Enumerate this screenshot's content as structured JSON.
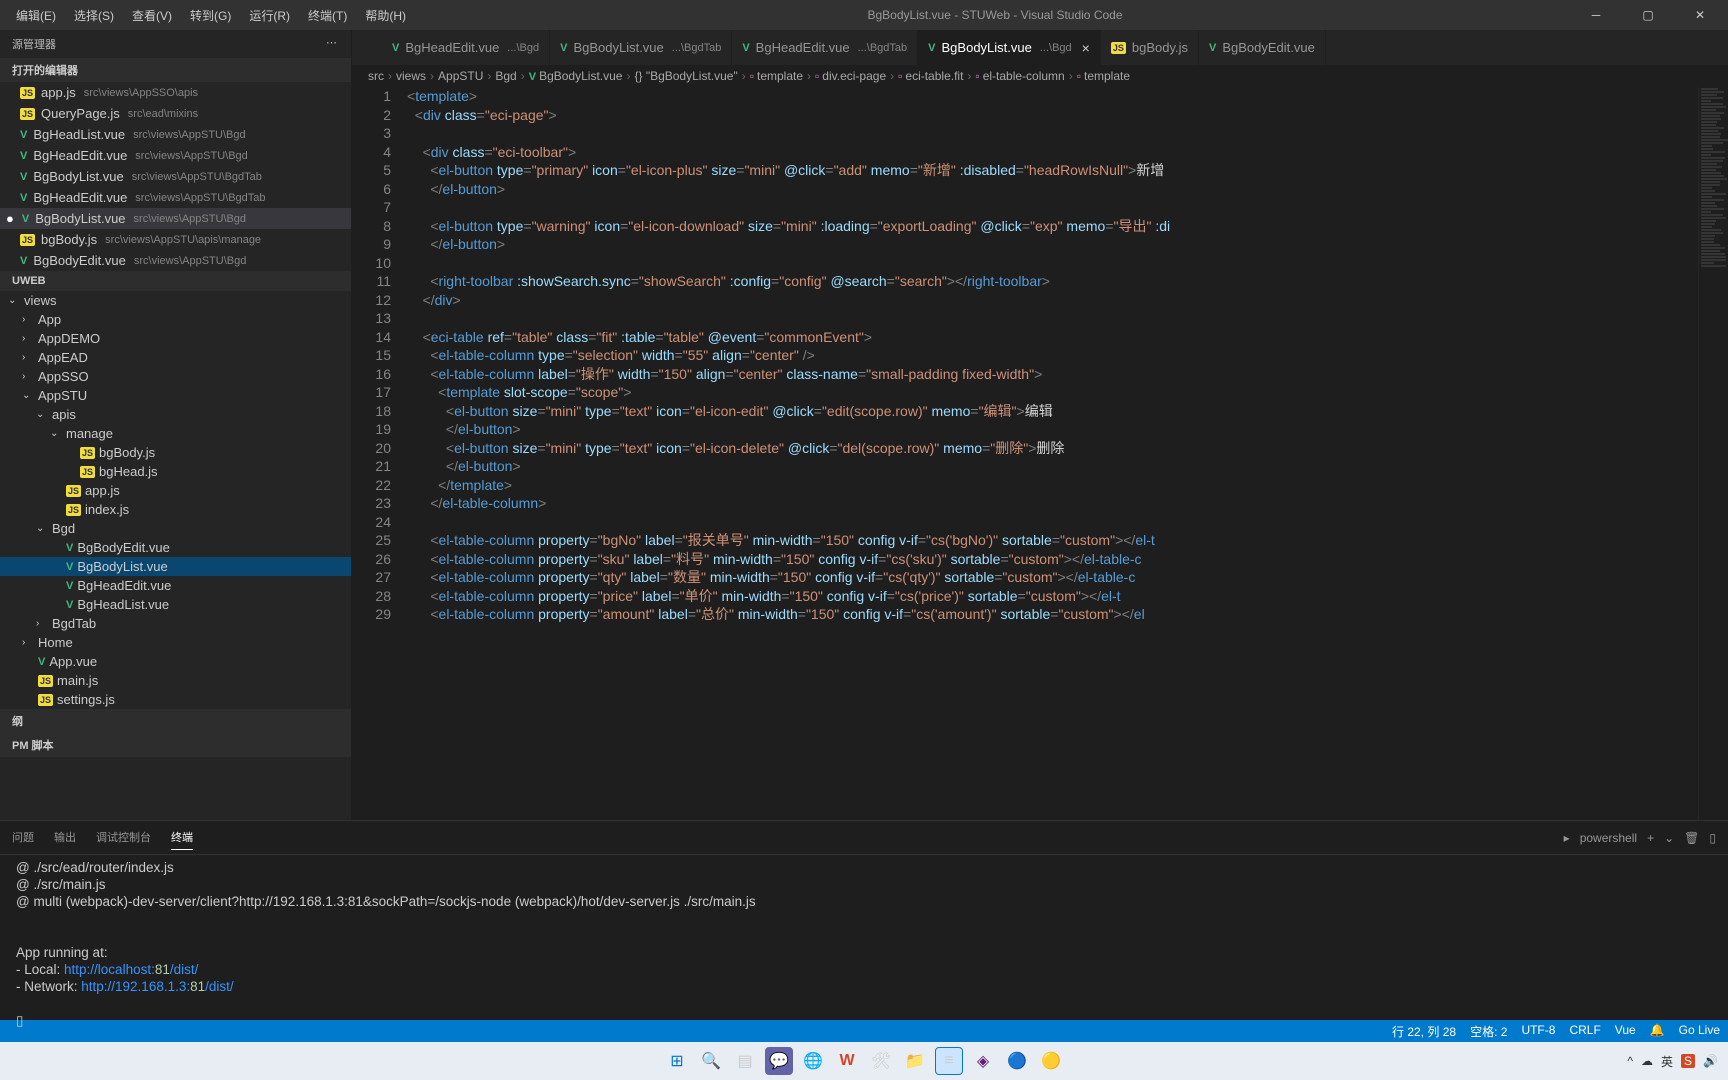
{
  "titlebar": {
    "menus": [
      "编辑(E)",
      "选择(S)",
      "查看(V)",
      "转到(G)",
      "运行(R)",
      "终端(T)",
      "帮助(H)"
    ],
    "title": "BgBodyList.vue - STUWeb - Visual Studio Code"
  },
  "sidebar": {
    "title": "源管理器",
    "section_open": "打开的编辑器",
    "open_editors": [
      {
        "icon": "js",
        "name": "app.js",
        "path": "src\\views\\AppSSO\\apis"
      },
      {
        "icon": "js",
        "name": "QueryPage.js",
        "path": "src\\ead\\mixins"
      },
      {
        "icon": "v",
        "name": "BgHeadList.vue",
        "path": "src\\views\\AppSTU\\Bgd"
      },
      {
        "icon": "v",
        "name": "BgHeadEdit.vue",
        "path": "src\\views\\AppSTU\\Bgd"
      },
      {
        "icon": "v",
        "name": "BgBodyList.vue",
        "path": "src\\views\\AppSTU\\BgdTab"
      },
      {
        "icon": "v",
        "name": "BgHeadEdit.vue",
        "path": "src\\views\\AppSTU\\BgdTab"
      },
      {
        "icon": "v",
        "name": "BgBodyList.vue",
        "path": "src\\views\\AppSTU\\Bgd",
        "active": true
      },
      {
        "icon": "js",
        "name": "bgBody.js",
        "path": "src\\views\\AppSTU\\apis\\manage"
      },
      {
        "icon": "v",
        "name": "BgBodyEdit.vue",
        "path": "src\\views\\AppSTU\\Bgd"
      }
    ],
    "project": "UWEB",
    "tree": [
      {
        "indent": 0,
        "chev": "⌄",
        "name": "views"
      },
      {
        "indent": 1,
        "chev": "›",
        "name": "App"
      },
      {
        "indent": 1,
        "chev": "›",
        "name": "AppDEMO"
      },
      {
        "indent": 1,
        "chev": "›",
        "name": "AppEAD"
      },
      {
        "indent": 1,
        "chev": "›",
        "name": "AppSSO"
      },
      {
        "indent": 1,
        "chev": "⌄",
        "name": "AppSTU"
      },
      {
        "indent": 2,
        "chev": "⌄",
        "name": "apis"
      },
      {
        "indent": 3,
        "chev": "⌄",
        "name": "manage"
      },
      {
        "indent": 4,
        "icon": "js",
        "name": "bgBody.js"
      },
      {
        "indent": 4,
        "icon": "js",
        "name": "bgHead.js"
      },
      {
        "indent": 3,
        "icon": "js",
        "name": "app.js"
      },
      {
        "indent": 3,
        "icon": "js",
        "name": "index.js"
      },
      {
        "indent": 2,
        "chev": "⌄",
        "name": "Bgd"
      },
      {
        "indent": 3,
        "icon": "v",
        "name": "BgBodyEdit.vue"
      },
      {
        "indent": 3,
        "icon": "v",
        "name": "BgBodyList.vue",
        "selected": true
      },
      {
        "indent": 3,
        "icon": "v",
        "name": "BgHeadEdit.vue"
      },
      {
        "indent": 3,
        "icon": "v",
        "name": "BgHeadList.vue"
      },
      {
        "indent": 2,
        "chev": "›",
        "name": "BgdTab"
      },
      {
        "indent": 1,
        "chev": "›",
        "name": "Home"
      },
      {
        "indent": 1,
        "icon": "v",
        "name": "App.vue"
      },
      {
        "indent": 1,
        "icon": "js",
        "name": "main.js"
      },
      {
        "indent": 1,
        "icon": "js",
        "name": "settings.js"
      }
    ],
    "outline": "纲",
    "npm": "PM 脚本"
  },
  "tabs": [
    {
      "icon": "v",
      "name": "BgHeadEdit.vue",
      "path": "...\\Bgd"
    },
    {
      "icon": "v",
      "name": "BgBodyList.vue",
      "path": "...\\BgdTab"
    },
    {
      "icon": "v",
      "name": "BgHeadEdit.vue",
      "path": "...\\BgdTab"
    },
    {
      "icon": "v",
      "name": "BgBodyList.vue",
      "path": "...\\Bgd",
      "active": true,
      "close": true
    },
    {
      "icon": "js",
      "name": "bgBody.js"
    },
    {
      "icon": "v",
      "name": "BgBodyEdit.vue"
    }
  ],
  "breadcrumb": [
    "src",
    "views",
    "AppSTU",
    "Bgd",
    "BgBodyList.vue",
    "{} \"BgBodyList.vue\"",
    "template",
    "div.eci-page",
    "eci-table.fit",
    "el-table-column",
    "template"
  ],
  "code": {
    "lines": [
      {
        "n": 1,
        "html": "<span class='punct'>&lt;</span><span class='tag'>template</span><span class='punct'>&gt;</span>"
      },
      {
        "n": 2,
        "html": "  <span class='punct'>&lt;</span><span class='tag'>div</span> <span class='attr'>class</span><span class='punct'>=</span><span class='str'>\"eci-page\"</span><span class='punct'>&gt;</span>"
      },
      {
        "n": 3,
        "html": ""
      },
      {
        "n": 4,
        "html": "    <span class='punct'>&lt;</span><span class='tag'>div</span> <span class='attr'>class</span><span class='punct'>=</span><span class='str'>\"eci-toolbar\"</span><span class='punct'>&gt;</span>"
      },
      {
        "n": 5,
        "html": "      <span class='punct'>&lt;</span><span class='tag'>el-button</span> <span class='attr'>type</span><span class='punct'>=</span><span class='str'>\"primary\"</span> <span class='attr'>icon</span><span class='punct'>=</span><span class='str'>\"el-icon-plus\"</span> <span class='attr'>size</span><span class='punct'>=</span><span class='str'>\"mini\"</span> <span class='attr'>@click</span><span class='punct'>=</span><span class='str'>\"add\"</span> <span class='attr'>memo</span><span class='punct'>=</span><span class='str'>\"新增\"</span> <span class='attr'>:disabled</span><span class='punct'>=</span><span class='str'>\"headRowIsNull\"</span><span class='punct'>&gt;</span><span class='text'>新增</span>"
      },
      {
        "n": 6,
        "html": "      <span class='punct'>&lt;/</span><span class='tag'>el-button</span><span class='punct'>&gt;</span>"
      },
      {
        "n": 7,
        "html": ""
      },
      {
        "n": 8,
        "html": "      <span class='punct'>&lt;</span><span class='tag'>el-button</span> <span class='attr'>type</span><span class='punct'>=</span><span class='str'>\"warning\"</span> <span class='attr'>icon</span><span class='punct'>=</span><span class='str'>\"el-icon-download\"</span> <span class='attr'>size</span><span class='punct'>=</span><span class='str'>\"mini\"</span> <span class='attr'>:loading</span><span class='punct'>=</span><span class='str'>\"exportLoading\"</span> <span class='attr'>@click</span><span class='punct'>=</span><span class='str'>\"exp\"</span> <span class='attr'>memo</span><span class='punct'>=</span><span class='str'>\"导出\"</span> <span class='attr'>:di</span>"
      },
      {
        "n": 9,
        "html": "      <span class='punct'>&lt;/</span><span class='tag'>el-button</span><span class='punct'>&gt;</span>"
      },
      {
        "n": 10,
        "html": ""
      },
      {
        "n": 11,
        "html": "      <span class='punct'>&lt;</span><span class='tag'>right-toolbar</span> <span class='attr'>:showSearch.sync</span><span class='punct'>=</span><span class='str'>\"showSearch\"</span> <span class='attr'>:config</span><span class='punct'>=</span><span class='str'>\"config\"</span> <span class='attr'>@search</span><span class='punct'>=</span><span class='str'>\"search\"</span><span class='punct'>&gt;&lt;/</span><span class='tag'>right-toolbar</span><span class='punct'>&gt;</span>"
      },
      {
        "n": 12,
        "html": "    <span class='punct'>&lt;/</span><span class='tag'>div</span><span class='punct'>&gt;</span>"
      },
      {
        "n": 13,
        "html": ""
      },
      {
        "n": 14,
        "html": "    <span class='punct'>&lt;</span><span class='tag'>eci-table</span> <span class='attr'>ref</span><span class='punct'>=</span><span class='str'>\"table\"</span> <span class='attr'>class</span><span class='punct'>=</span><span class='str'>\"fit\"</span> <span class='attr'>:table</span><span class='punct'>=</span><span class='str'>\"table\"</span> <span class='attr'>@event</span><span class='punct'>=</span><span class='str'>\"commonEvent\"</span><span class='punct'>&gt;</span>"
      },
      {
        "n": 15,
        "html": "      <span class='punct'>&lt;</span><span class='tag'>el-table-column</span> <span class='attr'>type</span><span class='punct'>=</span><span class='str'>\"selection\"</span> <span class='attr'>width</span><span class='punct'>=</span><span class='str'>\"55\"</span> <span class='attr'>align</span><span class='punct'>=</span><span class='str'>\"center\"</span> <span class='punct'>/&gt;</span>"
      },
      {
        "n": 16,
        "html": "      <span class='punct'>&lt;</span><span class='tag'>el-table-column</span> <span class='attr'>label</span><span class='punct'>=</span><span class='str'>\"操作\"</span> <span class='attr'>width</span><span class='punct'>=</span><span class='str'>\"150\"</span> <span class='attr'>align</span><span class='punct'>=</span><span class='str'>\"center\"</span> <span class='attr'>class-name</span><span class='punct'>=</span><span class='str'>\"small-padding fixed-width\"</span><span class='punct'>&gt;</span>"
      },
      {
        "n": 17,
        "html": "        <span class='punct'>&lt;</span><span class='tag'>template</span> <span class='attr'>slot-scope</span><span class='punct'>=</span><span class='str'>\"scope\"</span><span class='punct'>&gt;</span>"
      },
      {
        "n": 18,
        "html": "          <span class='punct'>&lt;</span><span class='tag'>el-button</span> <span class='attr'>size</span><span class='punct'>=</span><span class='str'>\"mini\"</span> <span class='attr'>type</span><span class='punct'>=</span><span class='str'>\"text\"</span> <span class='attr'>icon</span><span class='punct'>=</span><span class='str'>\"el-icon-edit\"</span> <span class='attr'>@click</span><span class='punct'>=</span><span class='str'>\"edit(scope.row)\"</span> <span class='attr'>memo</span><span class='punct'>=</span><span class='str'>\"编辑\"</span><span class='punct'>&gt;</span><span class='text'>编辑</span>"
      },
      {
        "n": 19,
        "html": "          <span class='punct'>&lt;/</span><span class='tag'>el-button</span><span class='punct'>&gt;</span>"
      },
      {
        "n": 20,
        "html": "          <span class='punct'>&lt;</span><span class='tag'>el-button</span> <span class='attr'>size</span><span class='punct'>=</span><span class='str'>\"mini\"</span> <span class='attr'>type</span><span class='punct'>=</span><span class='str'>\"text\"</span> <span class='attr'>icon</span><span class='punct'>=</span><span class='str'>\"el-icon-delete\"</span> <span class='attr'>@click</span><span class='punct'>=</span><span class='str'>\"del(scope.row)\"</span> <span class='attr'>memo</span><span class='punct'>=</span><span class='str'>\"删除\"</span><span class='punct'>&gt;</span><span class='text'>删除</span>"
      },
      {
        "n": 21,
        "html": "          <span class='punct'>&lt;/</span><span class='tag'>el-button</span><span class='punct'>&gt;</span>"
      },
      {
        "n": 22,
        "html": "        <span class='punct'>&lt;/</span><span class='tag'>template</span><span class='punct'>&gt;</span>"
      },
      {
        "n": 23,
        "html": "      <span class='punct'>&lt;/</span><span class='tag'>el-table-column</span><span class='punct'>&gt;</span>"
      },
      {
        "n": 24,
        "html": ""
      },
      {
        "n": 25,
        "html": "      <span class='punct'>&lt;</span><span class='tag'>el-table-column</span> <span class='attr'>property</span><span class='punct'>=</span><span class='str'>\"bgNo\"</span> <span class='attr'>label</span><span class='punct'>=</span><span class='str'>\"报关单号\"</span> <span class='attr'>min-width</span><span class='punct'>=</span><span class='str'>\"150\"</span> <span class='attr'>config</span> <span class='attr'>v-if</span><span class='punct'>=</span><span class='str'>\"cs('bgNo')\"</span> <span class='attr'>sortable</span><span class='punct'>=</span><span class='str'>\"custom\"</span><span class='punct'>&gt;&lt;/</span><span class='tag'>el-t</span>"
      },
      {
        "n": 26,
        "html": "      <span class='punct'>&lt;</span><span class='tag'>el-table-column</span> <span class='attr'>property</span><span class='punct'>=</span><span class='str'>\"sku\"</span> <span class='attr'>label</span><span class='punct'>=</span><span class='str'>\"料号\"</span> <span class='attr'>min-width</span><span class='punct'>=</span><span class='str'>\"150\"</span> <span class='attr'>config</span> <span class='attr'>v-if</span><span class='punct'>=</span><span class='str'>\"cs('sku')\"</span> <span class='attr'>sortable</span><span class='punct'>=</span><span class='str'>\"custom\"</span><span class='punct'>&gt;&lt;/</span><span class='tag'>el-table-c</span>"
      },
      {
        "n": 27,
        "html": "      <span class='punct'>&lt;</span><span class='tag'>el-table-column</span> <span class='attr'>property</span><span class='punct'>=</span><span class='str'>\"qty\"</span> <span class='attr'>label</span><span class='punct'>=</span><span class='str'>\"数量\"</span> <span class='attr'>min-width</span><span class='punct'>=</span><span class='str'>\"150\"</span> <span class='attr'>config</span> <span class='attr'>v-if</span><span class='punct'>=</span><span class='str'>\"cs('qty')\"</span> <span class='attr'>sortable</span><span class='punct'>=</span><span class='str'>\"custom\"</span><span class='punct'>&gt;&lt;/</span><span class='tag'>el-table-c</span>"
      },
      {
        "n": 28,
        "html": "      <span class='punct'>&lt;</span><span class='tag'>el-table-column</span> <span class='attr'>property</span><span class='punct'>=</span><span class='str'>\"price\"</span> <span class='attr'>label</span><span class='punct'>=</span><span class='str'>\"单价\"</span> <span class='attr'>min-width</span><span class='punct'>=</span><span class='str'>\"150\"</span> <span class='attr'>config</span> <span class='attr'>v-if</span><span class='punct'>=</span><span class='str'>\"cs('price')\"</span> <span class='attr'>sortable</span><span class='punct'>=</span><span class='str'>\"custom\"</span><span class='punct'>&gt;&lt;/</span><span class='tag'>el-t</span>"
      },
      {
        "n": 29,
        "html": "      <span class='punct'>&lt;</span><span class='tag'>el-table-column</span> <span class='attr'>property</span><span class='punct'>=</span><span class='str'>\"amount\"</span> <span class='attr'>label</span><span class='punct'>=</span><span class='str'>\"总价\"</span> <span class='attr'>min-width</span><span class='punct'>=</span><span class='str'>\"150\"</span> <span class='attr'>config</span> <span class='attr'>v-if</span><span class='punct'>=</span><span class='str'>\"cs('amount')\"</span> <span class='attr'>sortable</span><span class='punct'>=</span><span class='str'>\"custom\"</span><span class='punct'>&gt;&lt;/</span><span class='tag'>el</span>"
      }
    ]
  },
  "panel": {
    "tabs": [
      "问题",
      "输出",
      "调试控制台",
      "终端"
    ],
    "active_tab": 3,
    "shell": "powershell",
    "lines": [
      "@ ./src/ead/router/index.js",
      "@ ./src/main.js",
      "@ multi (webpack)-dev-server/client?http://192.168.1.3:81&sockPath=/sockjs-node (webpack)/hot/dev-server.js ./src/main.js",
      "",
      "",
      "  App running at:",
      "  - Local:   http://localhost:81/dist/",
      "  - Network: http://192.168.1.3:81/dist/",
      "",
      "▯"
    ]
  },
  "statusbar": {
    "position": "行 22, 列 28",
    "spaces": "空格: 2",
    "encoding": "UTF-8",
    "eol": "CRLF",
    "lang": "Vue",
    "golive": "Go Live"
  }
}
